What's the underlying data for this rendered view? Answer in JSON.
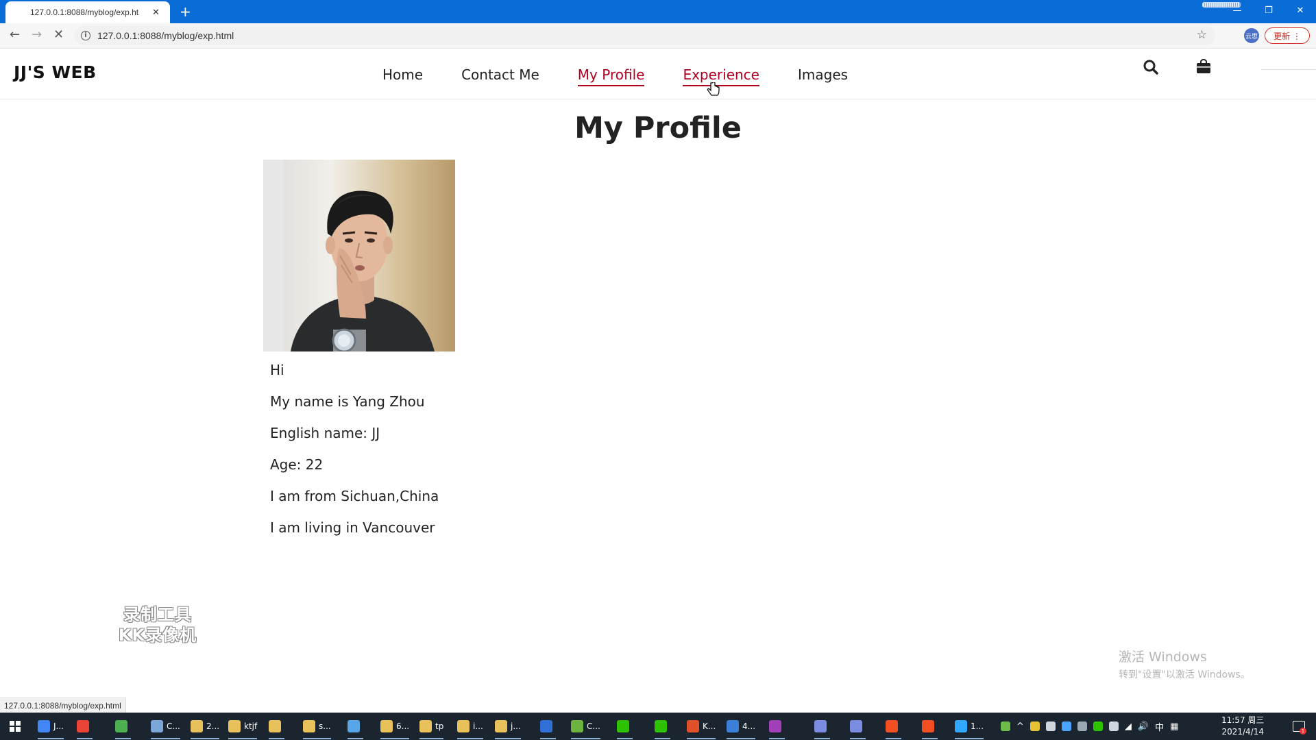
{
  "browser": {
    "tab_title": "127.0.0.1:8088/myblog/exp.ht",
    "tab_close": "✕",
    "new_tab": "+",
    "url": "127.0.0.1:8088/myblog/exp.html",
    "profile_label": "云思",
    "update_label": "更新 ⋮",
    "status_url": "127.0.0.1:8088/myblog/exp.html"
  },
  "site": {
    "logo": "JJ'S WEB",
    "nav": [
      {
        "label": "Home",
        "active": false
      },
      {
        "label": "Contact Me",
        "active": false
      },
      {
        "label": "My Profile",
        "active": true
      },
      {
        "label": "Experience",
        "active": true
      },
      {
        "label": "Images",
        "active": false
      }
    ],
    "accent_color": "#b00020"
  },
  "profile": {
    "title": "My Profile",
    "lines": [
      "Hi",
      "My name is Yang Zhou",
      "English name: JJ",
      "Age: 22",
      "I am from Sichuan,China",
      "I am living in Vancouver"
    ]
  },
  "overlay": {
    "watermark_line1": "录制工具",
    "watermark_line2": "KK录像机",
    "activate_line1": "激活 Windows",
    "activate_line2": "转到\"设置\"以激活 Windows。"
  },
  "taskbar": {
    "items": [
      {
        "label": "J...",
        "color": "#4285f4"
      },
      {
        "label": "",
        "color": "#ea4335"
      },
      {
        "label": "",
        "color": "#4caf50"
      },
      {
        "label": "C...",
        "color": "#7aa7d8"
      },
      {
        "label": "2...",
        "color": "#e8c15a"
      },
      {
        "label": "ktjf",
        "color": "#e8c15a"
      },
      {
        "label": "",
        "color": "#e8c15a"
      },
      {
        "label": "s...",
        "color": "#e8c15a"
      },
      {
        "label": "",
        "color": "#58a6e8"
      },
      {
        "label": "6...",
        "color": "#e8c15a"
      },
      {
        "label": "tp",
        "color": "#e8c15a"
      },
      {
        "label": "i...",
        "color": "#e8c15a"
      },
      {
        "label": "j...",
        "color": "#e8c15a"
      },
      {
        "label": "",
        "color": "#2f6fd6"
      },
      {
        "label": "C...",
        "color": "#6db33f"
      },
      {
        "label": "",
        "color": "#2dc100"
      },
      {
        "label": "",
        "color": "#2dc100"
      },
      {
        "label": "K...",
        "color": "#e0512b"
      },
      {
        "label": "4...",
        "color": "#3c7fd8"
      },
      {
        "label": "",
        "color": "#a13fb8"
      },
      {
        "label": "",
        "color": "#7b8be0"
      },
      {
        "label": "",
        "color": "#7b8be0"
      },
      {
        "label": "",
        "color": "#f25022"
      },
      {
        "label": "",
        "color": "#f25022"
      },
      {
        "label": "1...",
        "color": "#31a8ff"
      }
    ],
    "tray_ime": "中",
    "time": "11:57 周三",
    "date": "2021/4/14",
    "notification_count": "1"
  }
}
